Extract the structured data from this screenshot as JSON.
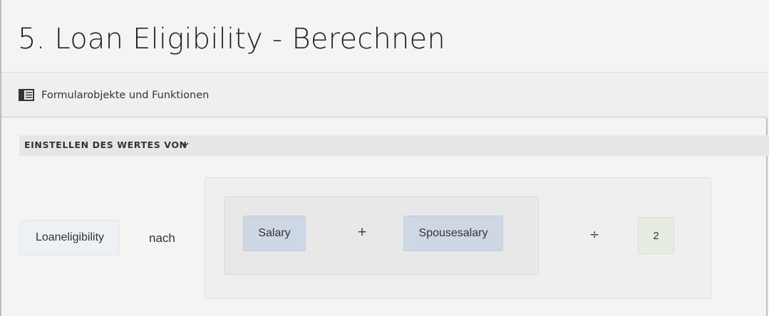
{
  "page": {
    "title": "5. Loan Eligibility - Berechnen"
  },
  "toolbar": {
    "icon": "form-objects-panel-icon",
    "label": "Formularobjekte und Funktionen"
  },
  "section": {
    "title": "EINSTELLEN DES WERTES VON",
    "icon": "chevron-down-icon"
  },
  "rule": {
    "target_field": "Loaneligibility",
    "connector": "nach",
    "expression": {
      "operand1": "Salary",
      "operator1": "+",
      "operand2": "Spousesalary",
      "operator2": "÷",
      "divisor": "2"
    }
  },
  "colors": {
    "background": "#f4f4f4",
    "variable_chip": "#ced8e5",
    "target_chip": "#edf1f6",
    "number_chip": "#e6ece2"
  }
}
